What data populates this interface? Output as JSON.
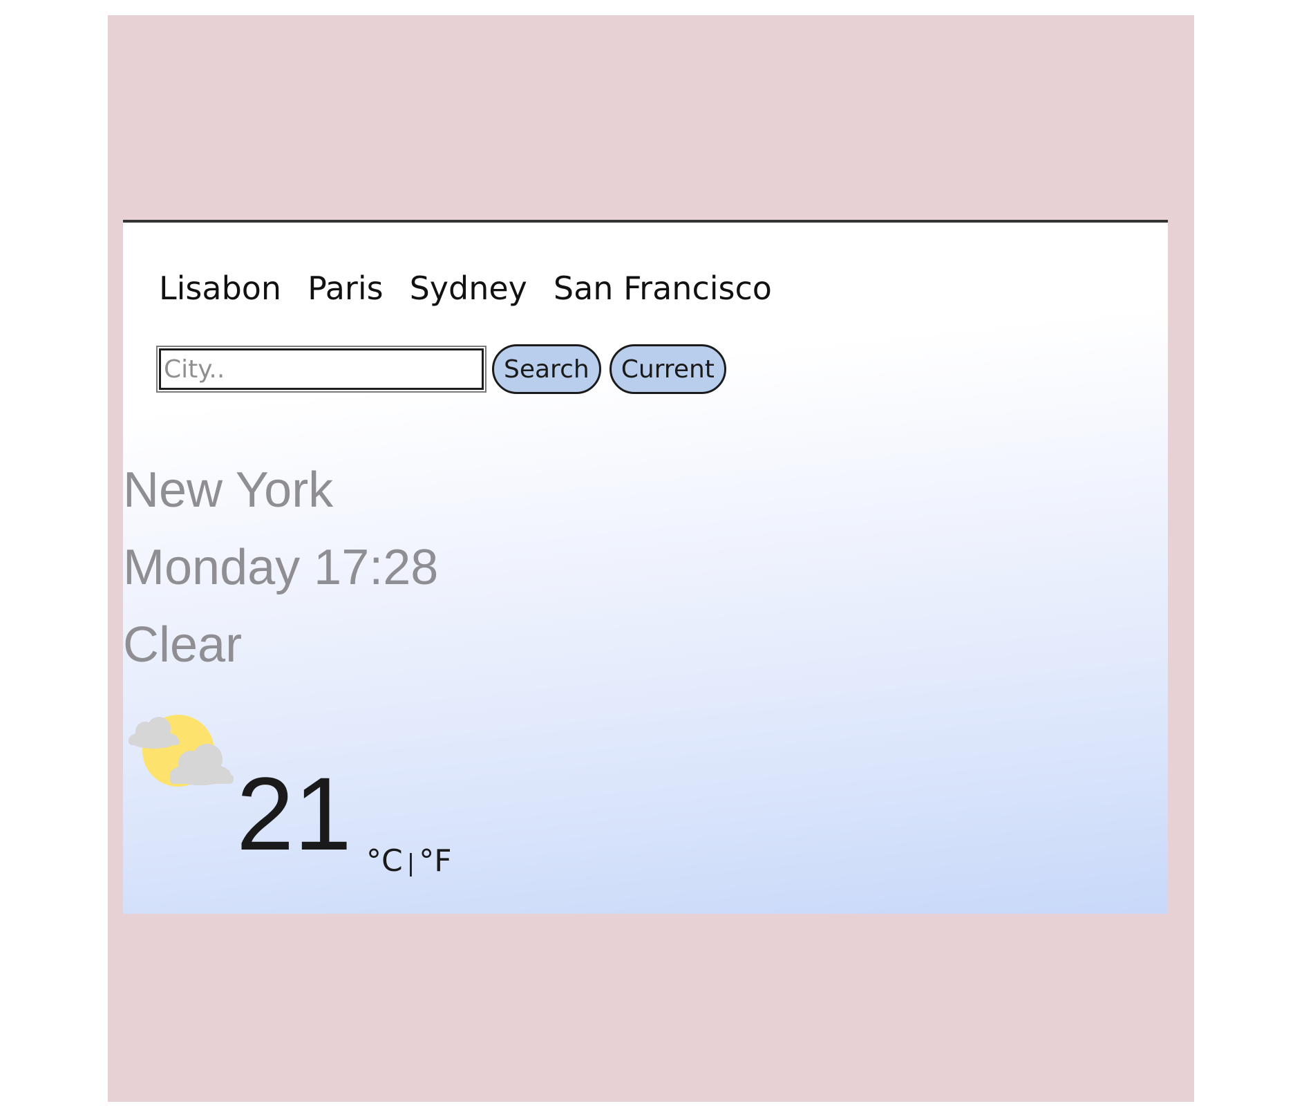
{
  "nav": {
    "cities": [
      "Lisabon",
      "Paris",
      "Sydney",
      "San Francisco"
    ]
  },
  "search": {
    "placeholder": "City..",
    "value": "",
    "search_label": "Search",
    "current_label": "Current"
  },
  "weather": {
    "city": "New York",
    "datetime": "Monday 17:28",
    "description": "Clear",
    "icon": "sun-behind-clouds-icon",
    "temperature": "21",
    "unit_celsius": "°C",
    "unit_separator": "|",
    "unit_fahrenheit": "°F"
  },
  "colors": {
    "page_background": "#e7d1d4",
    "button_fill": "#b9cdec",
    "gradient_bottom": "#c8d8f9",
    "muted_text": "#8e8e93"
  }
}
